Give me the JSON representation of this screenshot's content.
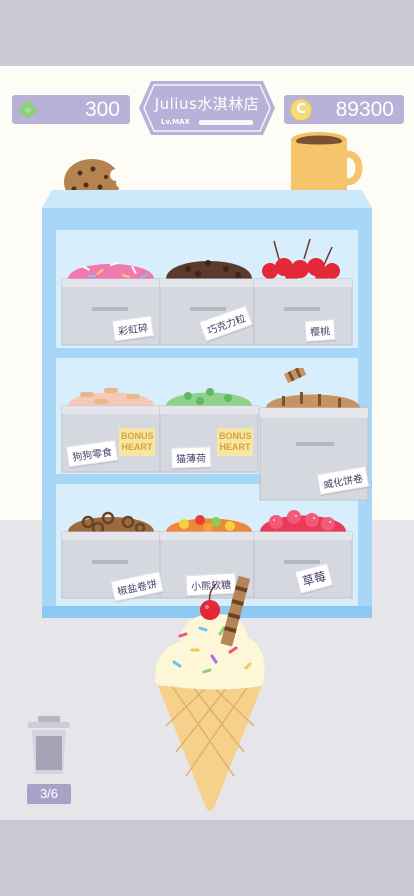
{
  "hud": {
    "hearts_count": "300",
    "coins": "89300",
    "coin_symbol": "C",
    "clover_icon": "clover-icon",
    "coin_icon": "coin-icon"
  },
  "shop_sign": {
    "title": "Julius水淇林店",
    "level_label": "Lv.MAX",
    "level_progress": 1.0
  },
  "toppings": [
    {
      "label": "彩虹碎"
    },
    {
      "label": "巧克力粒"
    },
    {
      "label": "樱桃"
    },
    {
      "label": "狗狗零食",
      "bonus": "BONUS HEART"
    },
    {
      "label": "猫薄荷",
      "bonus": "BONUS HEART"
    },
    {
      "label": "威化饼卷"
    },
    {
      "label": "椒盐卷饼"
    },
    {
      "label": "小熊软糖"
    },
    {
      "label": "草莓"
    }
  ],
  "trash": {
    "count": "3/6",
    "icon": "trash-can-icon"
  },
  "colors": {
    "pill": "#b9b2d8",
    "shelf": "#a8d6f7",
    "bin": "#d5d8df",
    "cone": "#f6d18c",
    "coffee": "#f2c162"
  }
}
